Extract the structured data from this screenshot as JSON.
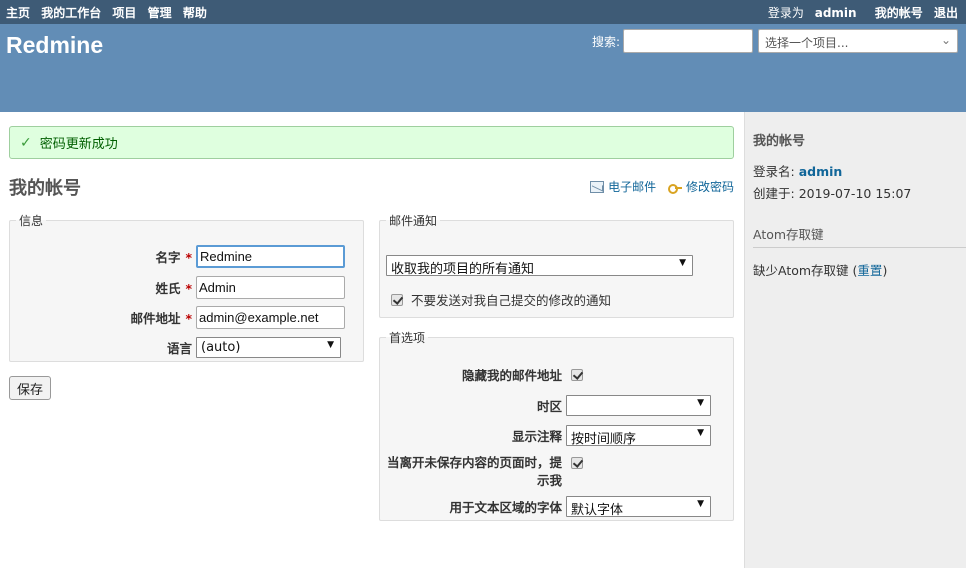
{
  "top_menu": {
    "left": [
      "主页",
      "我的工作台",
      "项目",
      "管理",
      "帮助"
    ],
    "logged_as_prefix": "登录为",
    "logged_as_user": "admin",
    "my_account": "我的帐号",
    "logout": "退出"
  },
  "header": {
    "title": "Redmine",
    "search_label": "搜索:",
    "search_value": "",
    "project_jump": "选择一个项目..."
  },
  "flash": {
    "message": "密码更新成功"
  },
  "page": {
    "title": "我的帐号",
    "email_link": "电子邮件",
    "change_password_link": "修改密码"
  },
  "info": {
    "legend": "信息",
    "firstname_label": "名字",
    "firstname_value": "Redmine",
    "lastname_label": "姓氏",
    "lastname_value": "Admin",
    "email_label": "邮件地址",
    "email_value": "admin@example.net",
    "language_label": "语言",
    "language_value": "(auto)"
  },
  "mail_notification": {
    "legend": "邮件通知",
    "selected": "收取我的项目的所有通知",
    "no_self_notified_label": "不要发送对我自己提交的修改的通知",
    "no_self_notified_checked": true
  },
  "preferences": {
    "legend": "首选项",
    "hide_mail_label": "隐藏我的邮件地址",
    "hide_mail_checked": true,
    "timezone_label": "时区",
    "timezone_value": "",
    "comments_order_label": "显示注释",
    "comments_order_value": "按时间顺序",
    "warn_unsaved_label_1": "当离开未保存内容的页面时，提",
    "warn_unsaved_label_2": "示我",
    "warn_unsaved_checked": true,
    "textarea_font_label": "用于文本区域的字体",
    "textarea_font_value": "默认字体"
  },
  "save_button": "保存",
  "sidebar": {
    "title": "我的帐号",
    "login_label": "登录名:",
    "login_value": "admin",
    "created_label": "创建于:",
    "created_value": "2019-07-10 15:07",
    "atom_title": "Atom存取键",
    "atom_missing": "缺少Atom存取键",
    "atom_reset": "重置"
  }
}
